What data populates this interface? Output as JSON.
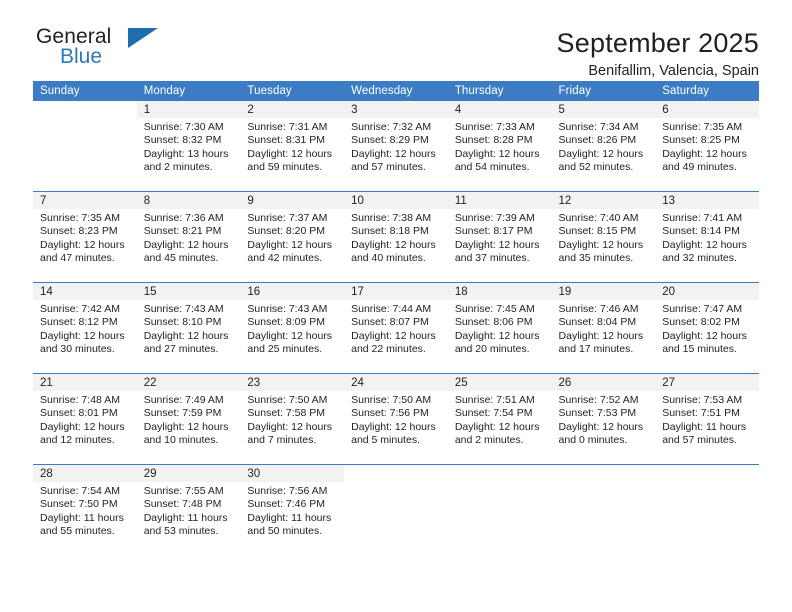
{
  "brand": {
    "name_dark": "General",
    "name_blue": "Blue",
    "accent_color": "#2e78bc",
    "triangle_color": "#1f6cb0"
  },
  "header": {
    "title": "September 2025",
    "subtitle": "Benifallim, Valencia, Spain",
    "header_bg_color": "#3b7cc4",
    "daynum_bg_color": "#f2f2f2"
  },
  "weekday_headers": [
    "Sunday",
    "Monday",
    "Tuesday",
    "Wednesday",
    "Thursday",
    "Friday",
    "Saturday"
  ],
  "weeks": [
    [
      {
        "day": "",
        "lines": []
      },
      {
        "day": "1",
        "lines": [
          "Sunrise: 7:30 AM",
          "Sunset: 8:32 PM",
          "Daylight: 13 hours",
          "and 2 minutes."
        ]
      },
      {
        "day": "2",
        "lines": [
          "Sunrise: 7:31 AM",
          "Sunset: 8:31 PM",
          "Daylight: 12 hours",
          "and 59 minutes."
        ]
      },
      {
        "day": "3",
        "lines": [
          "Sunrise: 7:32 AM",
          "Sunset: 8:29 PM",
          "Daylight: 12 hours",
          "and 57 minutes."
        ]
      },
      {
        "day": "4",
        "lines": [
          "Sunrise: 7:33 AM",
          "Sunset: 8:28 PM",
          "Daylight: 12 hours",
          "and 54 minutes."
        ]
      },
      {
        "day": "5",
        "lines": [
          "Sunrise: 7:34 AM",
          "Sunset: 8:26 PM",
          "Daylight: 12 hours",
          "and 52 minutes."
        ]
      },
      {
        "day": "6",
        "lines": [
          "Sunrise: 7:35 AM",
          "Sunset: 8:25 PM",
          "Daylight: 12 hours",
          "and 49 minutes."
        ]
      }
    ],
    [
      {
        "day": "7",
        "lines": [
          "Sunrise: 7:35 AM",
          "Sunset: 8:23 PM",
          "Daylight: 12 hours",
          "and 47 minutes."
        ]
      },
      {
        "day": "8",
        "lines": [
          "Sunrise: 7:36 AM",
          "Sunset: 8:21 PM",
          "Daylight: 12 hours",
          "and 45 minutes."
        ]
      },
      {
        "day": "9",
        "lines": [
          "Sunrise: 7:37 AM",
          "Sunset: 8:20 PM",
          "Daylight: 12 hours",
          "and 42 minutes."
        ]
      },
      {
        "day": "10",
        "lines": [
          "Sunrise: 7:38 AM",
          "Sunset: 8:18 PM",
          "Daylight: 12 hours",
          "and 40 minutes."
        ]
      },
      {
        "day": "11",
        "lines": [
          "Sunrise: 7:39 AM",
          "Sunset: 8:17 PM",
          "Daylight: 12 hours",
          "and 37 minutes."
        ]
      },
      {
        "day": "12",
        "lines": [
          "Sunrise: 7:40 AM",
          "Sunset: 8:15 PM",
          "Daylight: 12 hours",
          "and 35 minutes."
        ]
      },
      {
        "day": "13",
        "lines": [
          "Sunrise: 7:41 AM",
          "Sunset: 8:14 PM",
          "Daylight: 12 hours",
          "and 32 minutes."
        ]
      }
    ],
    [
      {
        "day": "14",
        "lines": [
          "Sunrise: 7:42 AM",
          "Sunset: 8:12 PM",
          "Daylight: 12 hours",
          "and 30 minutes."
        ]
      },
      {
        "day": "15",
        "lines": [
          "Sunrise: 7:43 AM",
          "Sunset: 8:10 PM",
          "Daylight: 12 hours",
          "and 27 minutes."
        ]
      },
      {
        "day": "16",
        "lines": [
          "Sunrise: 7:43 AM",
          "Sunset: 8:09 PM",
          "Daylight: 12 hours",
          "and 25 minutes."
        ]
      },
      {
        "day": "17",
        "lines": [
          "Sunrise: 7:44 AM",
          "Sunset: 8:07 PM",
          "Daylight: 12 hours",
          "and 22 minutes."
        ]
      },
      {
        "day": "18",
        "lines": [
          "Sunrise: 7:45 AM",
          "Sunset: 8:06 PM",
          "Daylight: 12 hours",
          "and 20 minutes."
        ]
      },
      {
        "day": "19",
        "lines": [
          "Sunrise: 7:46 AM",
          "Sunset: 8:04 PM",
          "Daylight: 12 hours",
          "and 17 minutes."
        ]
      },
      {
        "day": "20",
        "lines": [
          "Sunrise: 7:47 AM",
          "Sunset: 8:02 PM",
          "Daylight: 12 hours",
          "and 15 minutes."
        ]
      }
    ],
    [
      {
        "day": "21",
        "lines": [
          "Sunrise: 7:48 AM",
          "Sunset: 8:01 PM",
          "Daylight: 12 hours",
          "and 12 minutes."
        ]
      },
      {
        "day": "22",
        "lines": [
          "Sunrise: 7:49 AM",
          "Sunset: 7:59 PM",
          "Daylight: 12 hours",
          "and 10 minutes."
        ]
      },
      {
        "day": "23",
        "lines": [
          "Sunrise: 7:50 AM",
          "Sunset: 7:58 PM",
          "Daylight: 12 hours",
          "and 7 minutes."
        ]
      },
      {
        "day": "24",
        "lines": [
          "Sunrise: 7:50 AM",
          "Sunset: 7:56 PM",
          "Daylight: 12 hours",
          "and 5 minutes."
        ]
      },
      {
        "day": "25",
        "lines": [
          "Sunrise: 7:51 AM",
          "Sunset: 7:54 PM",
          "Daylight: 12 hours",
          "and 2 minutes."
        ]
      },
      {
        "day": "26",
        "lines": [
          "Sunrise: 7:52 AM",
          "Sunset: 7:53 PM",
          "Daylight: 12 hours",
          "and 0 minutes."
        ]
      },
      {
        "day": "27",
        "lines": [
          "Sunrise: 7:53 AM",
          "Sunset: 7:51 PM",
          "Daylight: 11 hours",
          "and 57 minutes."
        ]
      }
    ],
    [
      {
        "day": "28",
        "lines": [
          "Sunrise: 7:54 AM",
          "Sunset: 7:50 PM",
          "Daylight: 11 hours",
          "and 55 minutes."
        ]
      },
      {
        "day": "29",
        "lines": [
          "Sunrise: 7:55 AM",
          "Sunset: 7:48 PM",
          "Daylight: 11 hours",
          "and 53 minutes."
        ]
      },
      {
        "day": "30",
        "lines": [
          "Sunrise: 7:56 AM",
          "Sunset: 7:46 PM",
          "Daylight: 11 hours",
          "and 50 minutes."
        ]
      },
      {
        "day": "",
        "lines": []
      },
      {
        "day": "",
        "lines": []
      },
      {
        "day": "",
        "lines": []
      },
      {
        "day": "",
        "lines": []
      }
    ]
  ]
}
